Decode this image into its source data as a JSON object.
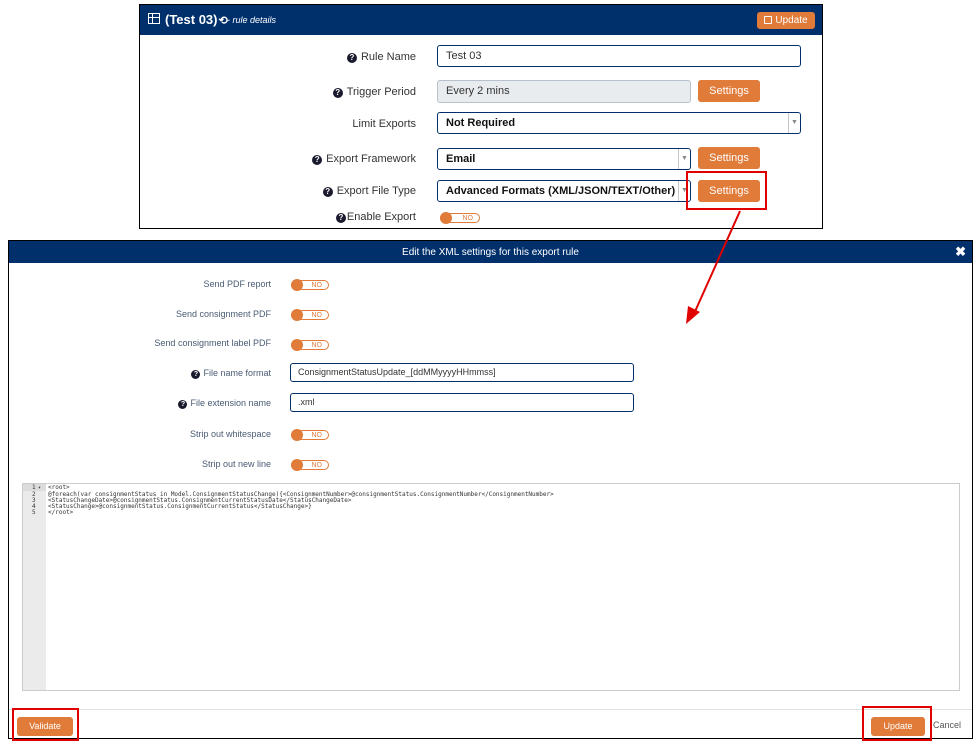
{
  "rule": {
    "title": "(Test 03)",
    "subtitle": "- rule details",
    "update_label": "Update",
    "fields": {
      "rule_name_label": "Rule Name",
      "rule_name_value": "Test 03",
      "trigger_period_label": "Trigger Period",
      "trigger_period_value": "Every 2 mins",
      "trigger_settings_label": "Settings",
      "limit_exports_label": "Limit Exports",
      "limit_exports_value": "Not Required",
      "export_framework_label": "Export Framework",
      "export_framework_value": "Email",
      "framework_settings_label": "Settings",
      "export_file_type_label": "Export File Type",
      "export_file_type_value": "Advanced Formats (XML/JSON/TEXT/Other)",
      "file_type_settings_label": "Settings",
      "enable_export_label": "Enable Export",
      "enable_export_state": "NO"
    }
  },
  "modal": {
    "title": "Edit the XML settings for this export rule",
    "close": "✖",
    "send_pdf_report_label": "Send PDF report",
    "send_pdf_report_state": "NO",
    "send_consignment_pdf_label": "Send consignment PDF",
    "send_consignment_pdf_state": "NO",
    "send_consignment_label_pdf_label": "Send consignment label PDF",
    "send_consignment_label_pdf_state": "NO",
    "file_name_format_label": "File name format",
    "file_name_format_value": "ConsignmentStatusUpdate_[ddMMyyyyHHmmss]",
    "file_extension_label": "File extension name",
    "file_extension_value": ".xml",
    "strip_whitespace_label": "Strip out whitespace",
    "strip_whitespace_state": "NO",
    "strip_newline_label": "Strip out new line",
    "strip_newline_state": "NO",
    "editor": {
      "line_numbers": [
        "1",
        "2",
        "3",
        "4",
        "5"
      ],
      "fold_marker": "▾",
      "code_lines": [
        "<root>",
        "@foreach(var consignmentStatus in Model.ConsignmentStatusChange){<ConsignmentNumber>@consignmentStatus.ConsignmentNumber</ConsignmentNumber>",
        "<StatusChangeDate>@consignmentStatus.ConsignmentCurrentStatusDate</StatusChangeDate>",
        "<StatusChange>@consignmentStatus.ConsignmentCurrentStatus</StatusChange>}",
        "</root>"
      ]
    },
    "validate_label": "Validate",
    "update_label": "Update",
    "cancel_label": "Cancel"
  },
  "colors": {
    "header_blue": "#00306b",
    "accent_orange": "#e07b39",
    "annotation_red": "#e00000"
  },
  "icons": {
    "table": "table-icon",
    "history": "history-icon",
    "save": "save-icon",
    "help": "question-circle-icon",
    "close": "close-icon",
    "dropdown": "chevron-down-icon"
  }
}
